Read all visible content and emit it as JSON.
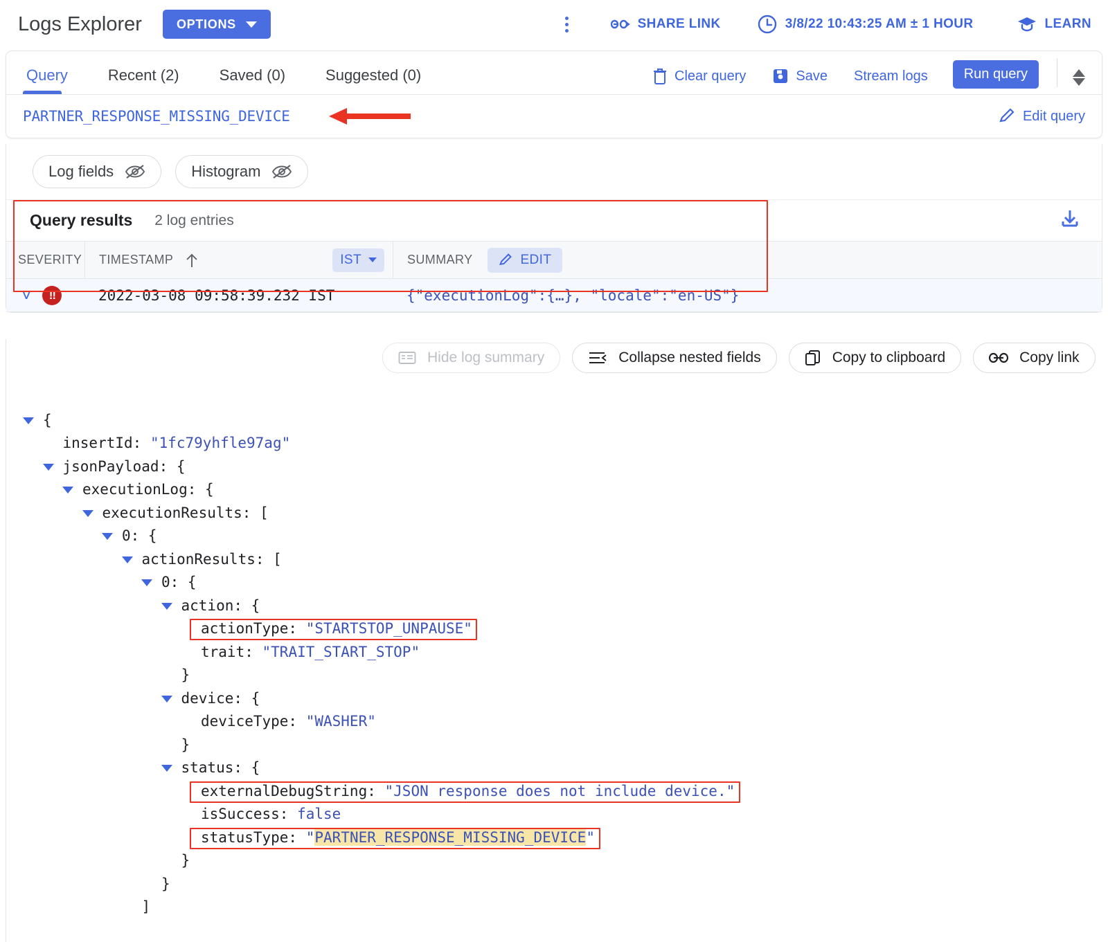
{
  "header": {
    "title": "Logs Explorer",
    "options_label": "OPTIONS",
    "kebab_name": "more-options",
    "share_link_label": "SHARE LINK",
    "time_range_label": "3/8/22 10:43:25 AM ± 1 HOUR",
    "learn_label": "LEARN"
  },
  "query_panel": {
    "tabs": [
      {
        "label": "Query",
        "active": true
      },
      {
        "label": "Recent (2)",
        "active": false
      },
      {
        "label": "Saved (0)",
        "active": false
      },
      {
        "label": "Suggested (0)",
        "active": false
      }
    ],
    "actions": {
      "clear_query": "Clear query",
      "save": "Save",
      "stream_logs": "Stream logs",
      "run_query": "Run query"
    },
    "query_text": "PARTNER_RESPONSE_MISSING_DEVICE",
    "edit_query": "Edit query"
  },
  "chips": [
    {
      "label": "Log fields",
      "icon": "eye-off-icon"
    },
    {
      "label": "Histogram",
      "icon": "eye-off-icon"
    }
  ],
  "results": {
    "title": "Query results",
    "count_label": "2 log entries",
    "download_icon": "download-icon",
    "columns": {
      "severity": "SEVERITY",
      "timestamp": "TIMESTAMP",
      "timezone": "IST",
      "summary": "SUMMARY",
      "edit": "EDIT"
    },
    "rows": [
      {
        "severity": "error",
        "severity_glyph": "!!",
        "timestamp": "2022-03-08 09:58:39.232 IST",
        "summary": "{\"executionLog\":{…}, \"locale\":\"en-US\"}"
      }
    ]
  },
  "detail_actions": [
    {
      "label": "Hide log summary",
      "icon": "summary-icon",
      "disabled": true
    },
    {
      "label": "Collapse nested fields",
      "icon": "collapse-icon",
      "disabled": false
    },
    {
      "label": "Copy to clipboard",
      "icon": "copy-icon",
      "disabled": false
    },
    {
      "label": "Copy link",
      "icon": "link-icon",
      "disabled": false
    }
  ],
  "json_tree": [
    {
      "indent": 0,
      "caret": "down",
      "text": "{"
    },
    {
      "indent": 1,
      "caret": "none",
      "key": "insertId",
      "value": "\"1fc79yhfle97ag\""
    },
    {
      "indent": 1,
      "caret": "down",
      "text": "jsonPayload: {"
    },
    {
      "indent": 2,
      "caret": "down",
      "text": "executionLog: {"
    },
    {
      "indent": 3,
      "caret": "down",
      "text": "executionResults: ["
    },
    {
      "indent": 4,
      "caret": "down",
      "text": "0: {"
    },
    {
      "indent": 5,
      "caret": "down",
      "text": "actionResults: ["
    },
    {
      "indent": 6,
      "caret": "down",
      "text": "0: {"
    },
    {
      "indent": 7,
      "caret": "down",
      "text": "action: {"
    },
    {
      "indent": 8,
      "caret": "none",
      "key": "actionType",
      "value": "\"STARTSTOP_UNPAUSE\"",
      "boxed": true
    },
    {
      "indent": 8,
      "caret": "none",
      "key": "trait",
      "value": "\"TRAIT_START_STOP\""
    },
    {
      "indent": 7,
      "caret": "none",
      "text": "}"
    },
    {
      "indent": 7,
      "caret": "down",
      "text": "device: {"
    },
    {
      "indent": 8,
      "caret": "none",
      "key": "deviceType",
      "value": "\"WASHER\""
    },
    {
      "indent": 7,
      "caret": "none",
      "text": "}"
    },
    {
      "indent": 7,
      "caret": "down",
      "text": "status: {"
    },
    {
      "indent": 8,
      "caret": "none",
      "key": "externalDebugString",
      "value": "\"JSON response does not include device.\"",
      "boxed": true
    },
    {
      "indent": 8,
      "caret": "none",
      "key": "isSuccess",
      "value": "false",
      "bool": true
    },
    {
      "indent": 8,
      "caret": "none",
      "key": "statusType",
      "value": "\"PARTNER_RESPONSE_MISSING_DEVICE\"",
      "boxed": true,
      "highlight": "PARTNER_RESPONSE_MISSING_DEVICE"
    },
    {
      "indent": 7,
      "caret": "none",
      "text": "}"
    },
    {
      "indent": 6,
      "caret": "none",
      "text": "}"
    },
    {
      "indent": 5,
      "caret": "none",
      "text": "]"
    }
  ],
  "colors": {
    "accent_blue": "#4a6ee0",
    "link_blue": "#3f66dd",
    "value_blue": "#3c51b5",
    "annotation_red": "#ea3323",
    "error_red": "#c5221f",
    "highlight_yellow": "#f7e6a8",
    "row_selected_bg": "#f5f8fe"
  }
}
